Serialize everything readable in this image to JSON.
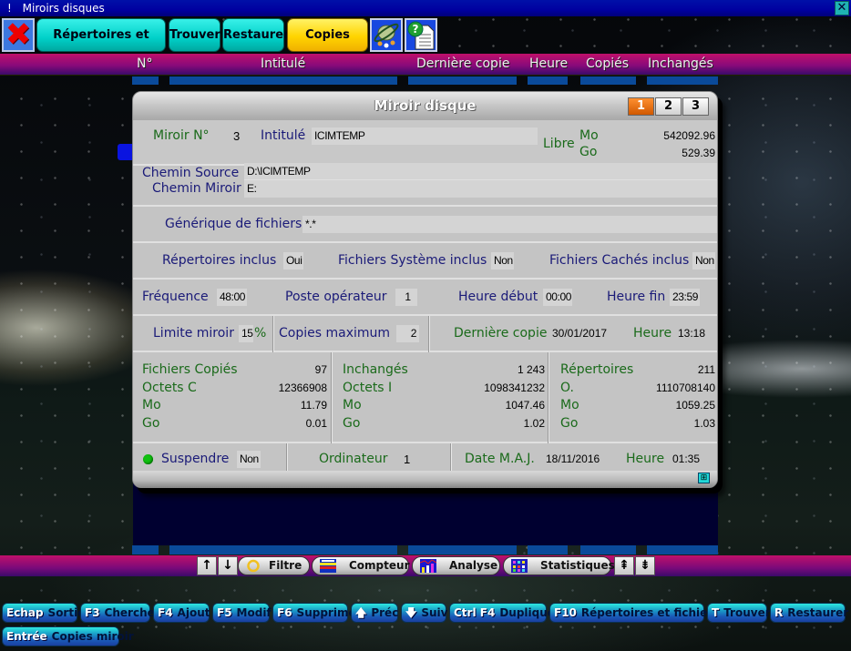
{
  "window": {
    "title_prefix": "!",
    "title": "Miroirs disques",
    "close_glyph": "✕"
  },
  "toolbar": {
    "exit_glyph": "✖",
    "tabs": [
      {
        "label": "Répertoires et fichiers",
        "active": false
      },
      {
        "label": "Trouver",
        "active": false
      },
      {
        "label": "Restaurer",
        "active": false
      },
      {
        "label": "Copies miroir",
        "active": true
      }
    ],
    "icons": [
      "planet-icon",
      "help-document-icon"
    ]
  },
  "columns": [
    "N°",
    "Intitulé",
    "Dernière copie",
    "Heure",
    "Copiés",
    "Inchangés"
  ],
  "dialog": {
    "title": "Miroir disque",
    "pages": [
      "1",
      "2",
      "3"
    ],
    "active_page": "1",
    "miroir_no_label": "Miroir N°",
    "miroir_no": "3",
    "intitule_label": "Intitulé",
    "intitule": "ICIMTEMP",
    "libre_label": "Libre",
    "libre_mo_label": "Mo",
    "libre_mo": "542092.96",
    "libre_go_label": "Go",
    "libre_go": "529.39",
    "chemin_source_label": "Chemin Source",
    "chemin_source": "D:\\ICIMTEMP",
    "chemin_miroir_label": "Chemin Miroir",
    "chemin_miroir": "E:",
    "generique_label": "Générique de fichiers",
    "generique": "*.*",
    "rep_inclus_label": "Répertoires inclus",
    "rep_inclus": "Oui",
    "sys_inclus_label": "Fichiers Système inclus",
    "sys_inclus": "Non",
    "caches_inclus_label": "Fichiers Cachés inclus",
    "caches_inclus": "Non",
    "frequence_label": "Fréquence",
    "frequence": "48:00",
    "poste_label": "Poste opérateur",
    "poste": "1",
    "heure_debut_label": "Heure début",
    "heure_debut": "00:00",
    "heure_fin_label": "Heure fin",
    "heure_fin": "23:59",
    "limite_label": "Limite miroir",
    "limite": "15",
    "limite_unit": "%",
    "copies_max_label": "Copies maximum",
    "copies_max": "2",
    "derniere_copie_label": "Dernière copie",
    "derniere_copie": "30/01/2017",
    "heure_label": "Heure",
    "derniere_heure": "13:18",
    "stats": {
      "copies": {
        "rows": [
          {
            "label": "Fichiers Copiés",
            "value": "97"
          },
          {
            "label": "Octets C",
            "value": "12366908"
          },
          {
            "label": "Mo",
            "value": "11.79"
          },
          {
            "label": "Go",
            "value": "0.01"
          }
        ]
      },
      "inchanges": {
        "rows": [
          {
            "label": "Inchangés",
            "value": "1 243"
          },
          {
            "label": "Octets I",
            "value": "1098341232"
          },
          {
            "label": "Mo",
            "value": "1047.46"
          },
          {
            "label": "Go",
            "value": "1.02"
          }
        ]
      },
      "repertoires": {
        "rows": [
          {
            "label": "Répertoires",
            "value": "211"
          },
          {
            "label": "O.",
            "value": "1110708140"
          },
          {
            "label": "Mo",
            "value": "1059.25"
          },
          {
            "label": "Go",
            "value": "1.03"
          }
        ]
      }
    },
    "suspendre_label": "Suspendre",
    "suspendre": "Non",
    "suspendre_status_color": "#10c010",
    "ordinateur_label": "Ordinateur",
    "ordinateur": "1",
    "date_maj_label": "Date M.A.J.",
    "date_maj": "18/11/2016",
    "heure_maj": "01:35"
  },
  "bottom_toolbar": {
    "up_glyph": "↑",
    "down_glyph": "↓",
    "filtre": "Filtre",
    "compteur": "Compteur",
    "analyse": "Analyse",
    "statistiques": "Statistiques",
    "first_glyph": "⇞",
    "last_glyph": "⇟"
  },
  "shortcuts": [
    {
      "key": "Echap",
      "label": "Sortie"
    },
    {
      "key": "F3",
      "label": "Cherche"
    },
    {
      "key": "F4",
      "label": "Ajout"
    },
    {
      "key": "F5",
      "label": "Modif"
    },
    {
      "key": "F6",
      "label": "Supprime"
    },
    {
      "key": "🡅",
      "label": "Préc"
    },
    {
      "key": "🡇",
      "label": "Suiv"
    },
    {
      "key": "Ctrl F4",
      "label": "Duplique"
    },
    {
      "key": "F10",
      "label": "Répertoires et fichiers"
    },
    {
      "key": "T",
      "label": "Trouver"
    },
    {
      "key": "R",
      "label": "Restaurer"
    },
    {
      "key": "Entrée",
      "label": "Copies miroir"
    }
  ]
}
